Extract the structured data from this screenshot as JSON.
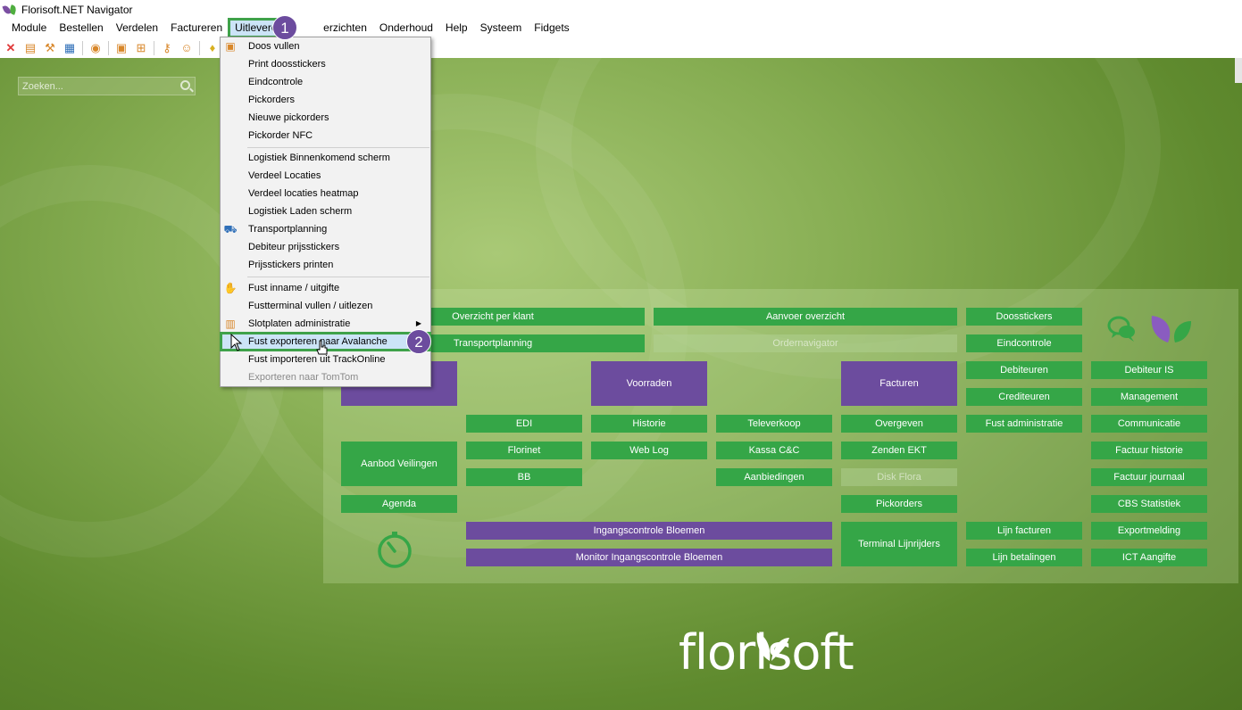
{
  "window": {
    "title": "Florisoft.NET Navigator"
  },
  "menubar": {
    "items": [
      "Module",
      "Bestellen",
      "Verdelen",
      "Factureren",
      "Uitleveren",
      "Overzichten",
      "Onderhoud",
      "Help",
      "Systeem",
      "Fidgets"
    ],
    "visible_labels": {
      "module": "Module",
      "bestellen": "Bestellen",
      "verdelen": "Verdelen",
      "factureren": "Factureren",
      "uitleveren": "Uitleveren",
      "overzichten": "erzichten",
      "onderhoud": "Onderhoud",
      "help": "Help",
      "systeem": "Systeem",
      "fidgets": "Fidgets"
    }
  },
  "search": {
    "placeholder": "Zoeken..."
  },
  "dropdown": {
    "items": [
      {
        "label": "Doos vullen",
        "icon": "box-icon"
      },
      {
        "label": "Print doosstickers"
      },
      {
        "label": "Eindcontrole"
      },
      {
        "label": "Pickorders"
      },
      {
        "label": "Nieuwe pickorders"
      },
      {
        "label": "Pickorder NFC"
      },
      {
        "label": "Logistiek Binnenkomend scherm"
      },
      {
        "label": "Verdeel Locaties"
      },
      {
        "label": "Verdeel locaties heatmap"
      },
      {
        "label": "Logistiek Laden scherm"
      },
      {
        "label": "Transportplanning",
        "icon": "truck-icon"
      },
      {
        "label": "Debiteur prijsstickers"
      },
      {
        "label": "Prijsstickers printen"
      },
      {
        "label": "Fust inname / uitgifte",
        "icon": "hand-box-icon"
      },
      {
        "label": "Fustterminal vullen / uitlezen"
      },
      {
        "label": "Slotplaten administratie",
        "icon": "crate-icon",
        "submenu": true
      },
      {
        "label": "Fust exporteren naar Avalanche",
        "highlighted": true
      },
      {
        "label": "Fust importeren uit TrackOnline"
      },
      {
        "label": "Exporteren naar TomTom",
        "disabled": true
      }
    ]
  },
  "badges": {
    "step1": "1",
    "step2": "2"
  },
  "tiles": {
    "overzicht_per_klant": "Overzicht per klant",
    "aanvoer_overzicht": "Aanvoer overzicht",
    "doosstickers": "Doosstickers",
    "transportplanning": "Transportplanning",
    "ordernavigator": "Ordernavigator",
    "eindcontrole": "Eindcontrole",
    "voorraden": "Voorraden",
    "facturen": "Facturen",
    "debiteuren": "Debiteuren",
    "debiteur_is": "Debiteur IS",
    "crediteuren": "Crediteuren",
    "management": "Management",
    "edi": "EDI",
    "historie": "Historie",
    "televerkoop": "Televerkoop",
    "overgeven": "Overgeven",
    "fust_administratie": "Fust administratie",
    "communicatie": "Communicatie",
    "aanbod_veilingen": "Aanbod Veilingen",
    "florinet": "Florinet",
    "web_log": "Web Log",
    "kassa_cc": "Kassa C&C",
    "zenden_ekt": "Zenden EKT",
    "factuur_historie": "Factuur historie",
    "bb": "BB",
    "aanbiedingen": "Aanbiedingen",
    "disk_flora": "Disk Flora",
    "factuur_journaal": "Factuur journaal",
    "agenda": "Agenda",
    "pickorders": "Pickorders",
    "cbs_statistiek": "CBS Statistiek",
    "ingangscontrole_bloemen": "Ingangscontrole Bloemen",
    "terminal_lijnrijders": "Terminal Lijnrijders",
    "lijn_facturen": "Lijn facturen",
    "exportmelding": "Exportmelding",
    "monitor_ingangscontrole": "Monitor Ingangscontrole Bloemen",
    "lijn_betalingen": "Lijn betalingen",
    "ict_aangifte": "ICT Aangifte"
  },
  "brand": {
    "logo_text": "florisoft"
  },
  "colors": {
    "green_tile": "#35a647",
    "purple_tile": "#6c4c9e",
    "highlight_green": "#3fa24a",
    "menu_highlight": "#cce4f7"
  }
}
